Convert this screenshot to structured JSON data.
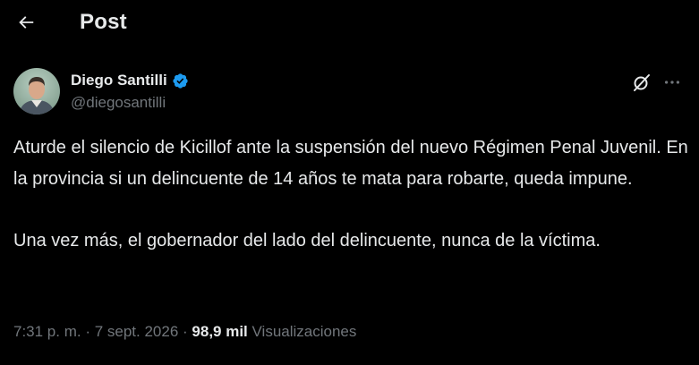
{
  "header": {
    "back_icon": "arrow-left-icon",
    "title": "Post"
  },
  "author": {
    "display_name": "Diego Santilli",
    "handle": "@diegosantilli",
    "verified_icon": "verified-badge-icon",
    "verified_color": "#1d9bf0"
  },
  "actions": {
    "grok_icon": "grok-icon",
    "more_icon": "more-horizontal-icon"
  },
  "tweet": {
    "paragraph_1": "Aturde el silencio de Kicillof ante la suspensión del nuevo Régimen Penal Juvenil. En la provincia si un delincuente de 14 años te mata para robarte, queda impune.",
    "paragraph_2": "Una vez más, el gobernador del lado del delincuente, nunca de la víctima."
  },
  "meta": {
    "time": "7:31 p. m.",
    "separator_1": " · ",
    "date": "7 sept. 2026",
    "separator_2": " · ",
    "views_count": "98,9 mil",
    "views_label": "Visualizaciones"
  }
}
